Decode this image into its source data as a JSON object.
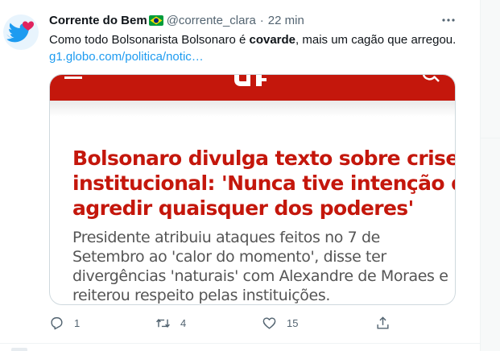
{
  "tweet": {
    "author_name": "Corrente do Bem",
    "handle": "@corrente_clara",
    "separator": "·",
    "time": "22 min",
    "text_before": "Como todo Bolsonarista Bolsonaro é ",
    "text_bold": "covarde",
    "text_after": ", mais um cagão que arregou.",
    "link": "g1.globo.com/politica/notic…",
    "card": {
      "headline_lines": [
        "Bolsonaro divulga texto sobre crise",
        "institucional: 'Nunca tive intenção de",
        "agredir quaisquer dos poderes'"
      ],
      "summary_lines": [
        "Presidente atribuiu ataques feitos no 7 de",
        "Setembro ao 'calor do momento', disse ter",
        "divergências 'naturais' com Alexandre de Moraes e",
        "reiterou respeito pelas instituições."
      ]
    },
    "actions": {
      "reply_count": "1",
      "retweet_count": "4",
      "like_count": "15"
    }
  },
  "icons": {
    "avatar": "twitter-bird-with-heart-icon",
    "flag": "brazil-flag-icon",
    "more": "more-horizontal-icon",
    "reply": "reply-icon",
    "retweet": "retweet-icon",
    "like": "heart-icon",
    "share": "share-icon"
  },
  "colors": {
    "accent": "#1d9bf0",
    "g1_red": "#c4170c",
    "muted": "#536471"
  }
}
